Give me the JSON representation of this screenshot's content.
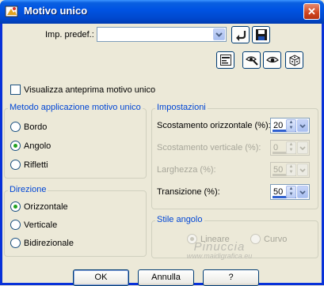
{
  "window": {
    "title": "Motivo unico",
    "close_glyph": "✕",
    "icon": "paint-program-icon"
  },
  "preset": {
    "label": "Imp. predef.:",
    "value": "",
    "icons": [
      "load-preset-icon",
      "save-preset-icon"
    ]
  },
  "toolbar": {
    "icons": [
      "preview-toggle-icon",
      "eye-pan-icon",
      "eye-icon",
      "randomize-dice-icon"
    ]
  },
  "preview_checkbox": {
    "label": "Visualizza anteprima motivo unico",
    "checked": false
  },
  "method_group": {
    "title": "Metodo applicazione motivo unico",
    "options": [
      {
        "label": "Bordo",
        "selected": false
      },
      {
        "label": "Angolo",
        "selected": true
      },
      {
        "label": "Rifletti",
        "selected": false
      }
    ]
  },
  "direction_group": {
    "title": "Direzione",
    "options": [
      {
        "label": "Orizzontale",
        "selected": true
      },
      {
        "label": "Verticale",
        "selected": false
      },
      {
        "label": "Bidirezionale",
        "selected": false
      }
    ]
  },
  "settings_group": {
    "title": "Impostazioni",
    "fields": [
      {
        "label": "Scostamento orizzontale (%):",
        "value": "20",
        "enabled": true
      },
      {
        "label": "Scostamento verticale (%):",
        "value": "0",
        "enabled": false
      },
      {
        "label": "Larghezza (%):",
        "value": "50",
        "enabled": false
      },
      {
        "label": "Transizione (%):",
        "value": "50",
        "enabled": true
      }
    ]
  },
  "corner_style_group": {
    "title": "Stile angolo",
    "options": [
      {
        "label": "Lineare",
        "selected": true,
        "enabled": false
      },
      {
        "label": "Curvo",
        "selected": false,
        "enabled": false
      }
    ]
  },
  "buttons": {
    "ok": "OK",
    "cancel": "Annulla",
    "help": "?"
  },
  "watermark": {
    "line1": "Pinuccia",
    "line2": "www.maidigrafica.eu"
  },
  "colors": {
    "title_bar": "#0054e3",
    "group_title": "#0046d5",
    "dialog_bg": "#ece9d8"
  }
}
